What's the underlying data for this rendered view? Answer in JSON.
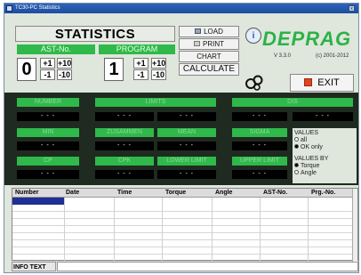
{
  "window": {
    "title": "TC30-PC Statistics",
    "close_glyph": "x"
  },
  "header": {
    "title": "STATISTICS"
  },
  "ast": {
    "label": "AST-No.",
    "value": "0",
    "plus1": "+1",
    "plus10": "+10",
    "minus1": "-1",
    "minus10": "-10"
  },
  "program": {
    "label": "PROGRAM",
    "value": "1",
    "plus1": "+1",
    "plus10": "+10",
    "minus1": "-1",
    "minus10": "-10"
  },
  "buttons": {
    "load": "LOAD",
    "print": "PRINT",
    "chart": "CHART",
    "calculate": "CALCULATE",
    "exit": "EXIT"
  },
  "brand": {
    "name": "DEPRAG",
    "version": "V 3.3.0",
    "copyright": "(c) 2001-2012"
  },
  "stats_grid": {
    "placeholder": "- - -",
    "green_labels": [
      "NUMBER",
      "LIMITS",
      "DIS",
      "MIN",
      "ZUSAMMEN",
      "MEAN",
      "SIGMA",
      "CP",
      "CPK",
      "LOWER LIMIT",
      "UPPER LIMIT"
    ]
  },
  "values_box": {
    "title": "VALUES",
    "opt_all": "all",
    "opt_ok": "OK only",
    "selected": "OK only"
  },
  "values_by_box": {
    "title": "VALUES BY",
    "opt_torque": "Torque",
    "opt_angle": "Angle",
    "selected": "Torque"
  },
  "table": {
    "columns": [
      "Number",
      "Date",
      "Time",
      "Torque",
      "Angle",
      "AST-No.",
      "Prg.-No."
    ],
    "rows": []
  },
  "info": {
    "label": "INFO TEXT",
    "value": ""
  },
  "colors": {
    "accent_green": "#2fb94a",
    "exit_red": "#e0441c",
    "selection_blue": "#1f2f96"
  },
  "icons": [
    "info-icon",
    "tools-icon",
    "load-icon",
    "print-icon",
    "exit-icon"
  ]
}
